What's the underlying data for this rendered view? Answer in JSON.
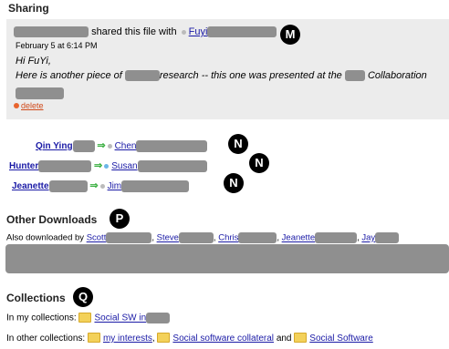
{
  "sharing": {
    "title": "Sharing",
    "share_text": "shared this file with",
    "share_target": "Fuyi",
    "date": "February 5 at 6:14 PM",
    "greeting": "Hi FuYi,",
    "body_start": "Here is another piece of",
    "body_mid": "research -- this one was presented at the",
    "body_end": "Collaboration",
    "dash": "--",
    "delete_label": "delete",
    "badge": "M"
  },
  "shares": [
    {
      "from": "Qin Ying",
      "to": "Chen"
    },
    {
      "from": "Hunter",
      "to": "Susan"
    },
    {
      "from": "Jeanette",
      "to": "Jim"
    }
  ],
  "share_badge": "N",
  "arrow_glyph": "⇒",
  "downloads": {
    "title": "Other Downloads",
    "badge": "P",
    "prefix": "Also downloaded by",
    "users": [
      "Scott",
      "Steve",
      "Chris",
      "Jeanette",
      "Jay"
    ]
  },
  "collections": {
    "title": "Collections",
    "badge": "Q",
    "mine_prefix": "In my collections:",
    "mine": "Social SW in",
    "other_prefix": "In other collections:",
    "other": [
      "my interests",
      "Social software collateral",
      "Social Software"
    ],
    "and_word": "and"
  }
}
